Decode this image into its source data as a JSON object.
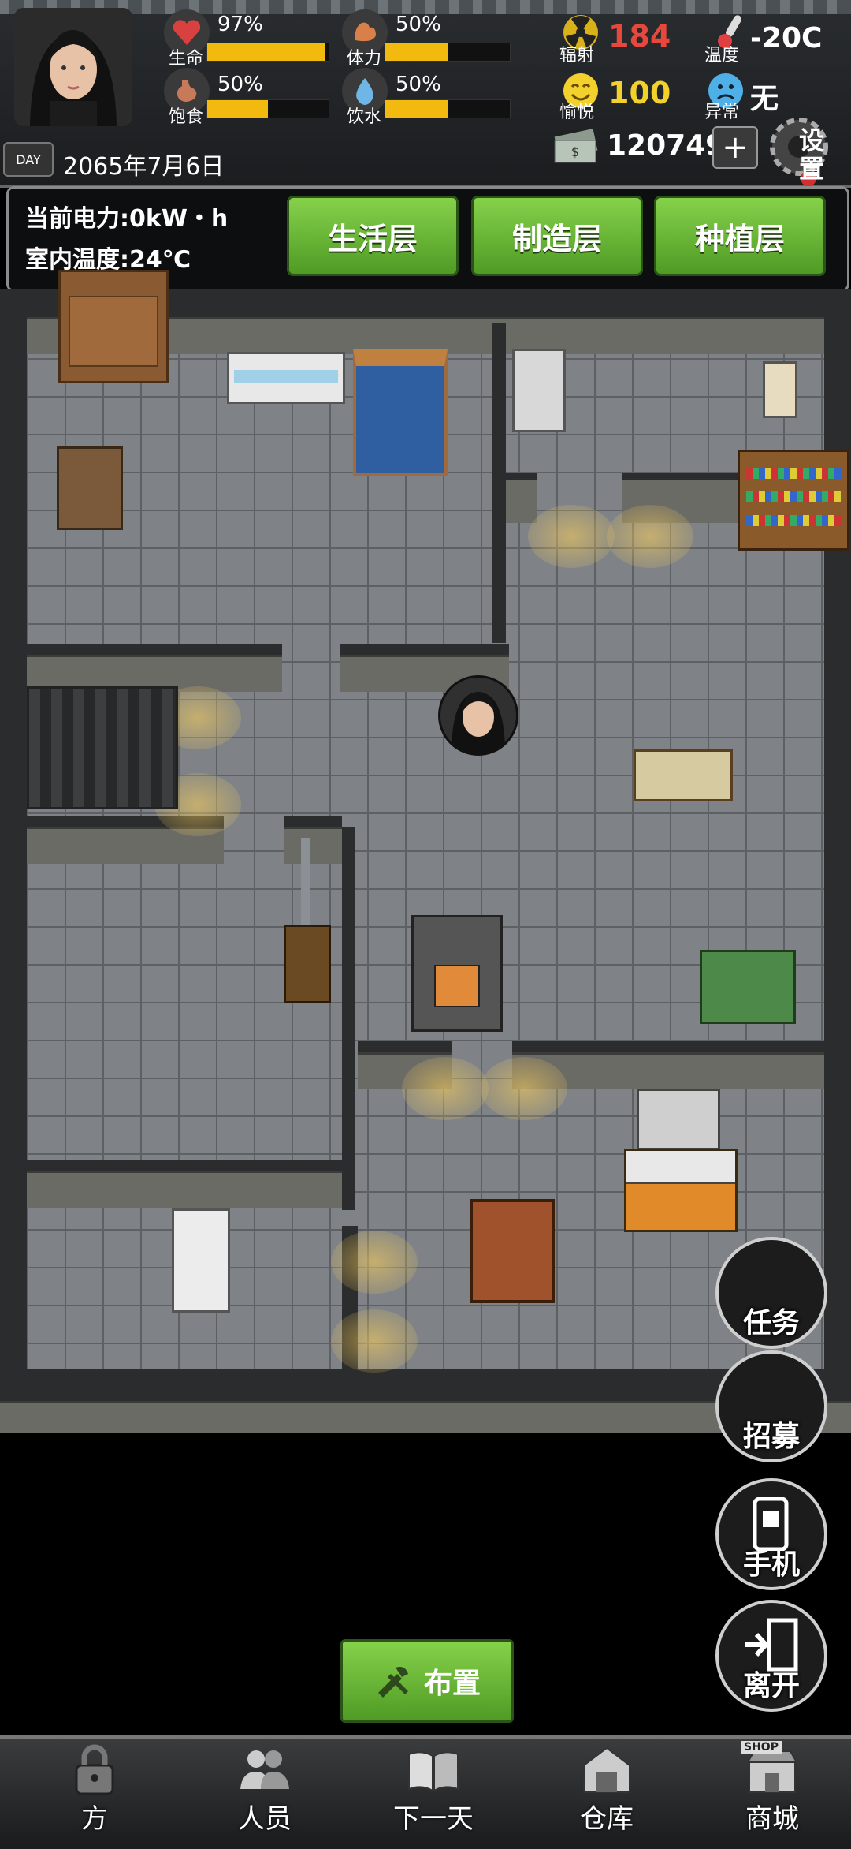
{
  "hud": {
    "stats": [
      {
        "label": "生命",
        "percent": "97%",
        "fill": 0.97,
        "icon": "heart-icon",
        "color": "#d94040"
      },
      {
        "label": "体力",
        "percent": "50%",
        "fill": 0.5,
        "icon": "muscle-icon",
        "color": "#d8804a"
      },
      {
        "label": "饱食",
        "percent": "50%",
        "fill": 0.5,
        "icon": "stomach-icon",
        "color": "#c77a5a"
      },
      {
        "label": "饮水",
        "percent": "50%",
        "fill": 0.5,
        "icon": "water-drop-icon",
        "color": "#6fb6e6"
      }
    ],
    "date": "2065年7月6日",
    "day_badge": "DAY",
    "radiation": {
      "label": "辐射",
      "value": "184",
      "color": "#e8483c"
    },
    "joy": {
      "label": "愉悦",
      "value": "100",
      "color": "#f3d12c"
    },
    "temperature": {
      "label": "温度",
      "value": "-20C"
    },
    "abnormal": {
      "label": "异常",
      "value": "无"
    },
    "money": "120749",
    "add_label": "+",
    "settings_label": "设置"
  },
  "info": {
    "power": "当前电力:0kW・h",
    "indoor_temp": "室内温度:24℃"
  },
  "layers": [
    "生活层",
    "制造层",
    "种植层"
  ],
  "actions": [
    "任务",
    "招募",
    "手机",
    "离开"
  ],
  "place_button": "布置",
  "nav": [
    "方",
    "人员",
    "下一天",
    "仓库",
    "商城"
  ],
  "shop_sign": "SHOP",
  "colors": {
    "accent_green": "#6fbf3a",
    "bar_yellow": "#f2b90f"
  }
}
